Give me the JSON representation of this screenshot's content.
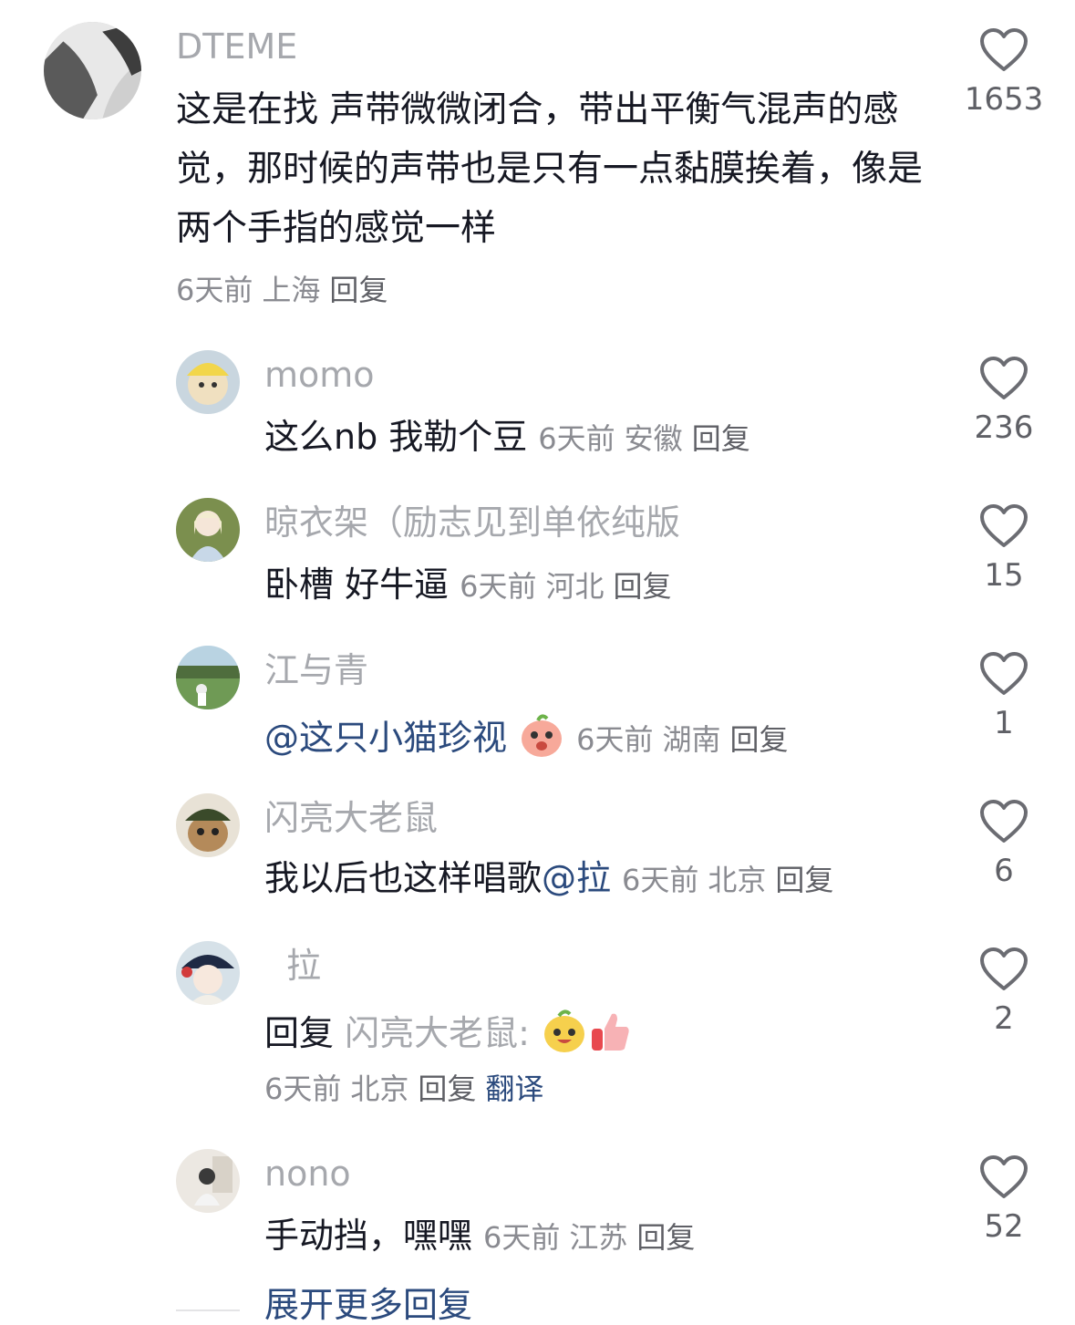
{
  "main_comment": {
    "username": "DTEME",
    "text": "这是在找 声带微微闭合，带出平衡气混声的感觉，那时候的声带也是只有一点黏膜挨着，像是两个手指的感觉一样",
    "time": "6天前",
    "location": "上海",
    "reply_label": "回复",
    "likes": "1653",
    "avatar_icon": "avatar-grayscale-photo"
  },
  "replies": [
    {
      "username": "momo",
      "text": "这么nb 我勒个豆",
      "time": "6天前",
      "location": "安徽",
      "reply_label": "回复",
      "likes": "236"
    },
    {
      "username": "晾衣架（励志见到单依纯版",
      "text": "卧槽 好牛逼",
      "time": "6天前",
      "location": "河北",
      "reply_label": "回复",
      "likes": "15"
    },
    {
      "username": "江与青",
      "mention": "@这只小猫珍视",
      "time": "6天前",
      "location": "湖南",
      "reply_label": "回复",
      "likes": "1"
    },
    {
      "username": "闪亮大老鼠",
      "text": "我以后也这样唱歌",
      "mention": "@拉",
      "time": "6天前",
      "location": "北京",
      "reply_label": "回复",
      "likes": "6"
    },
    {
      "username": "拉",
      "reply_prefix": "回复",
      "reply_to": "闪亮大老鼠:",
      "time": "6天前",
      "location": "北京",
      "reply_label": "回复",
      "translate_label": "翻译",
      "likes": "2"
    },
    {
      "username": "nono",
      "text": "手动挡，嘿嘿",
      "time": "6天前",
      "location": "江苏",
      "reply_label": "回复",
      "likes": "52"
    }
  ],
  "expand_label": "展开更多回复",
  "icons": {
    "like": "heart-outline-icon"
  },
  "colors": {
    "mention": "#2b4a7d",
    "username": "#a6a8ad",
    "meta": "#8a8b91"
  }
}
